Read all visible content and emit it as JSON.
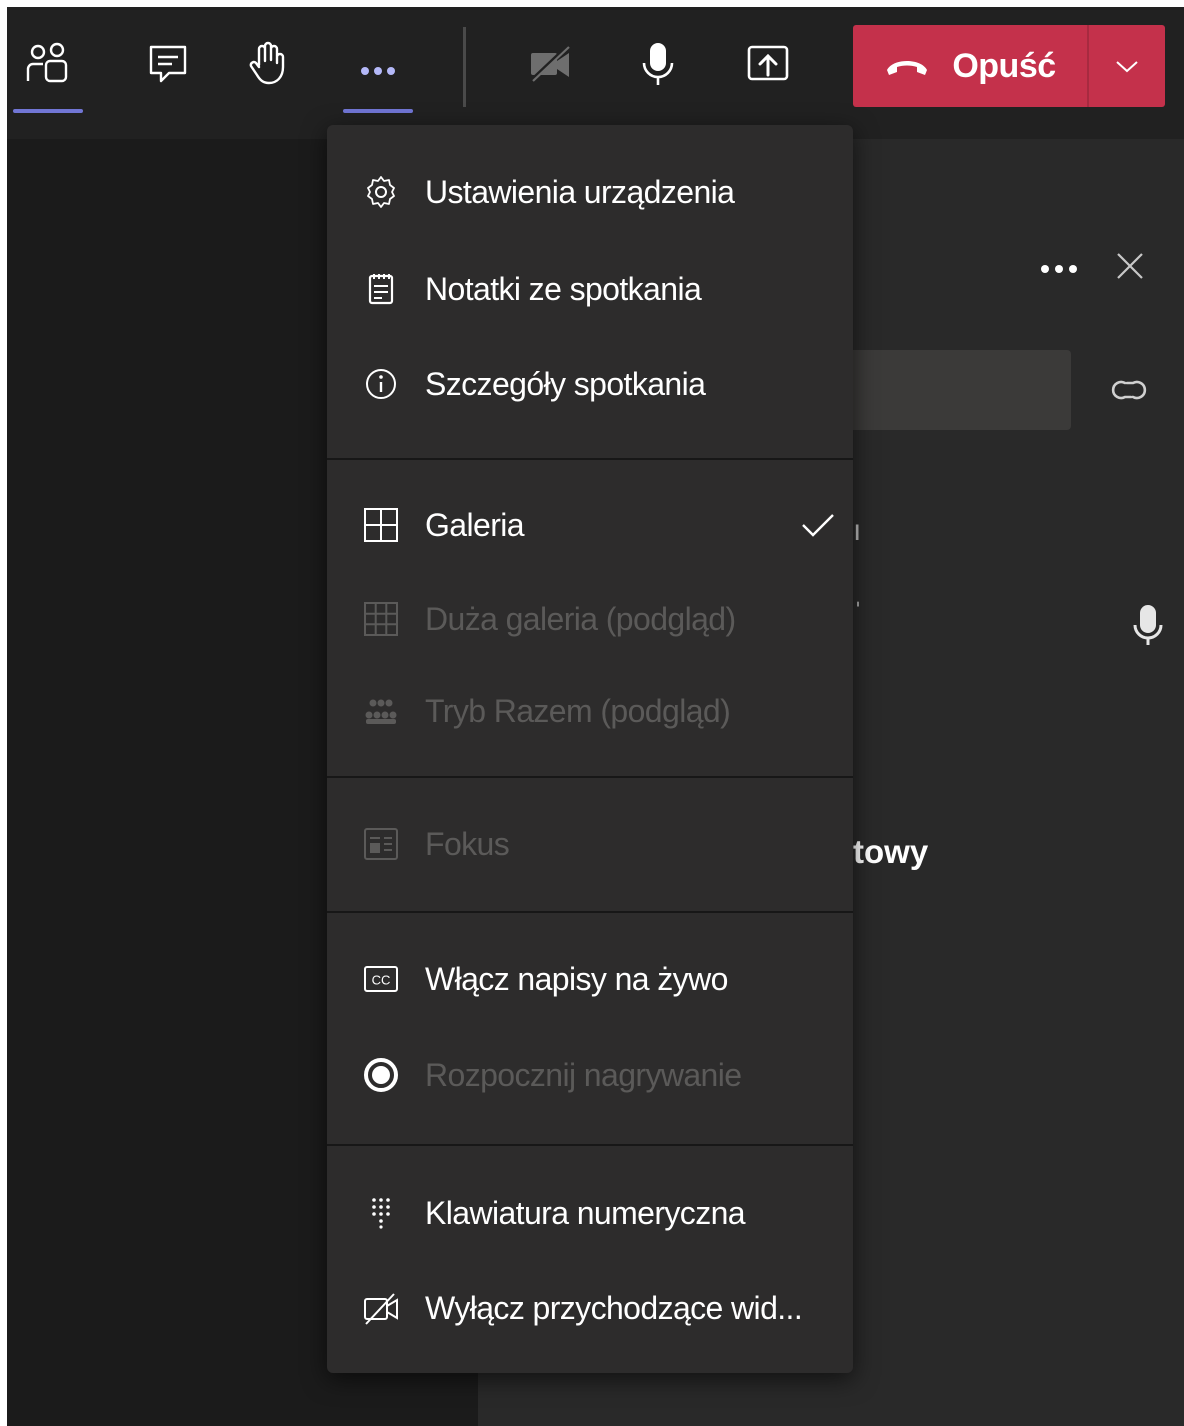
{
  "toolbar": {
    "buttons": [
      {
        "name": "participants",
        "icon": "people-icon",
        "active": true
      },
      {
        "name": "chat",
        "icon": "chat-icon",
        "active": false
      },
      {
        "name": "raise-hand",
        "icon": "hand-icon",
        "active": false
      },
      {
        "name": "more-actions",
        "icon": "more-icon",
        "active": true
      },
      {
        "name": "camera",
        "icon": "camera-off-icon",
        "active": false
      },
      {
        "name": "microphone",
        "icon": "mic-icon",
        "active": false
      },
      {
        "name": "share",
        "icon": "share-tray-icon",
        "active": false
      }
    ],
    "leave": {
      "label": "Opuść",
      "icon": "hang-up-icon",
      "color": "#c4314b"
    }
  },
  "menu": {
    "sections": [
      {
        "items": [
          {
            "label": "Ustawienia urządzenia",
            "icon": "gear-icon",
            "enabled": true
          },
          {
            "label": "Notatki ze spotkania",
            "icon": "notes-icon",
            "enabled": true
          },
          {
            "label": "Szczegóły spotkania",
            "icon": "info-icon",
            "enabled": true
          }
        ]
      },
      {
        "items": [
          {
            "label": "Galeria",
            "icon": "grid-icon",
            "enabled": true,
            "checked": true
          },
          {
            "label": "Duża galeria (podgląd)",
            "icon": "large-grid-icon",
            "enabled": false
          },
          {
            "label": "Tryb Razem (podgląd)",
            "icon": "together-mode-icon",
            "enabled": false
          }
        ]
      },
      {
        "items": [
          {
            "label": "Fokus",
            "icon": "focus-icon",
            "enabled": false
          }
        ]
      },
      {
        "items": [
          {
            "label": "Włącz napisy na żywo",
            "icon": "cc-icon",
            "enabled": true
          },
          {
            "label": "Rozpocznij nagrywanie",
            "icon": "record-icon",
            "enabled": false
          }
        ]
      },
      {
        "items": [
          {
            "label": "Klawiatura numeryczna",
            "icon": "dialpad-icon",
            "enabled": true
          },
          {
            "label": "Wyłącz przychodzące wid...",
            "icon": "video-off-icon",
            "enabled": true
          }
        ]
      }
    ]
  },
  "side_panel": {
    "visible_text": "towy"
  },
  "colors": {
    "accent": "#7f85f5",
    "leave_red": "#c4314b",
    "menu_bg": "#2d2c2c",
    "disabled_text": "#5b5a59"
  }
}
